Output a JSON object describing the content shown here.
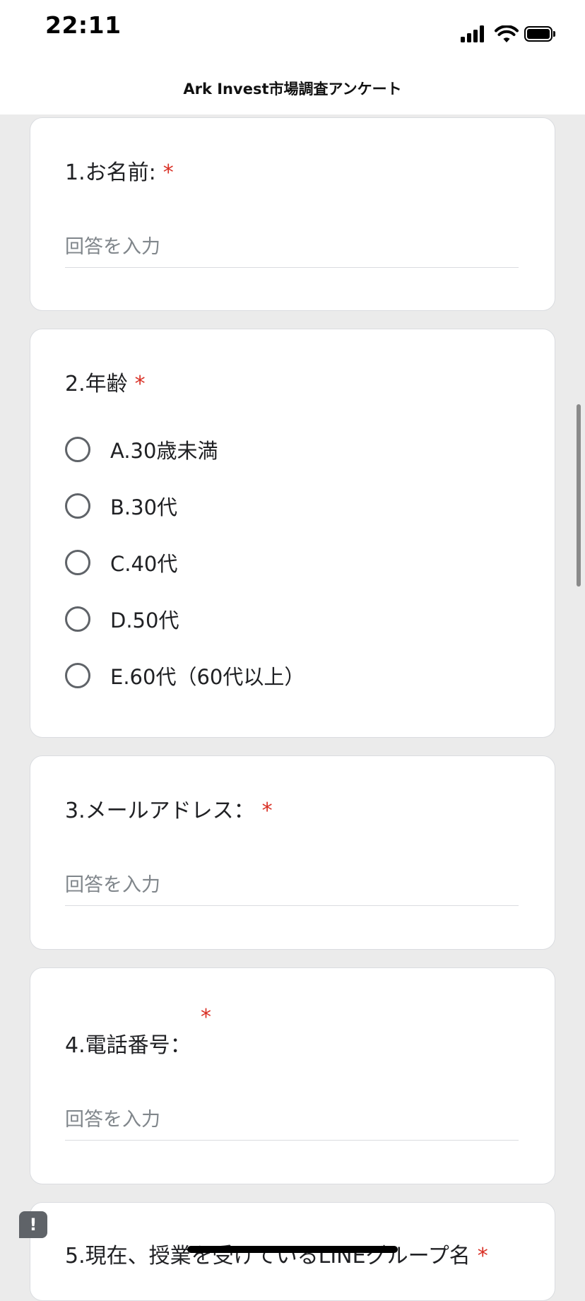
{
  "status_bar": {
    "time": "22:11"
  },
  "header": {
    "title": "Ark Invest市場調査アンケート"
  },
  "questions": [
    {
      "title": "1.お名前:",
      "required_mark": "*",
      "placeholder": "回答を入力"
    },
    {
      "title": "2.年齢",
      "required_mark": "*",
      "options": [
        "A.30歳未満",
        "B.30代",
        "C.40代",
        "D.50代",
        "E.60代（60代以上）"
      ]
    },
    {
      "title": "3.メールアドレス：",
      "required_mark": "*",
      "placeholder": "回答を入力"
    },
    {
      "title": "4.電話番号：",
      "required_mark": "*",
      "placeholder": "回答を入力"
    },
    {
      "title": "5.現在、授業を受けているLINEグループ名",
      "required_mark": "*"
    }
  ],
  "feedback": {
    "label": "!"
  },
  "colors": {
    "required": "#d93025",
    "page_bg": "#ebebeb",
    "card_border": "#dadce0"
  },
  "icons": [
    "cellular-signal-icon",
    "wifi-icon",
    "battery-icon",
    "feedback-icon"
  ]
}
